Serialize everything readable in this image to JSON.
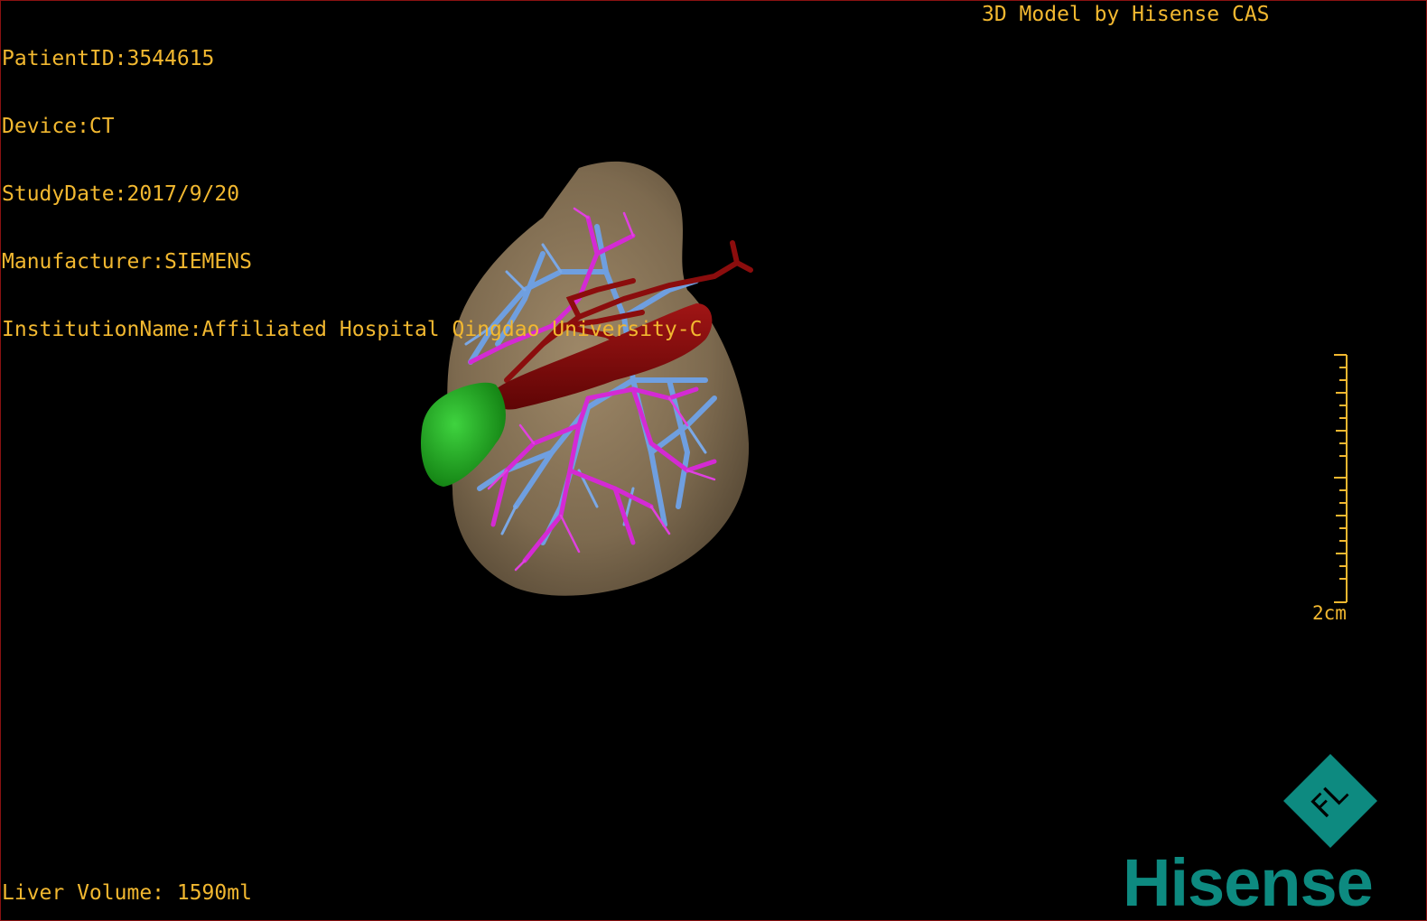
{
  "info": {
    "patient_id": "PatientID:3544615",
    "device": "Device:CT",
    "study_date": "StudyDate:2017/9/20",
    "manufacturer": "Manufacturer:SIEMENS",
    "institution": "InstitutionName:Affiliated Hospital Qingdao University-C"
  },
  "model_credit": "3D Model by Hisense CAS",
  "liver_volume": "Liver Volume: 1590ml",
  "scale": {
    "label": "2cm"
  },
  "brand": {
    "name": "Hisense",
    "mark_text": "FL",
    "color": "#0d8a80"
  },
  "model_colors": {
    "liver": "#8a7456",
    "portal_vein": "#d42ad4",
    "hepatic_vein": "#6f9fe0",
    "artery": "#8b0d0d",
    "gallbladder": "#1aa51a"
  }
}
